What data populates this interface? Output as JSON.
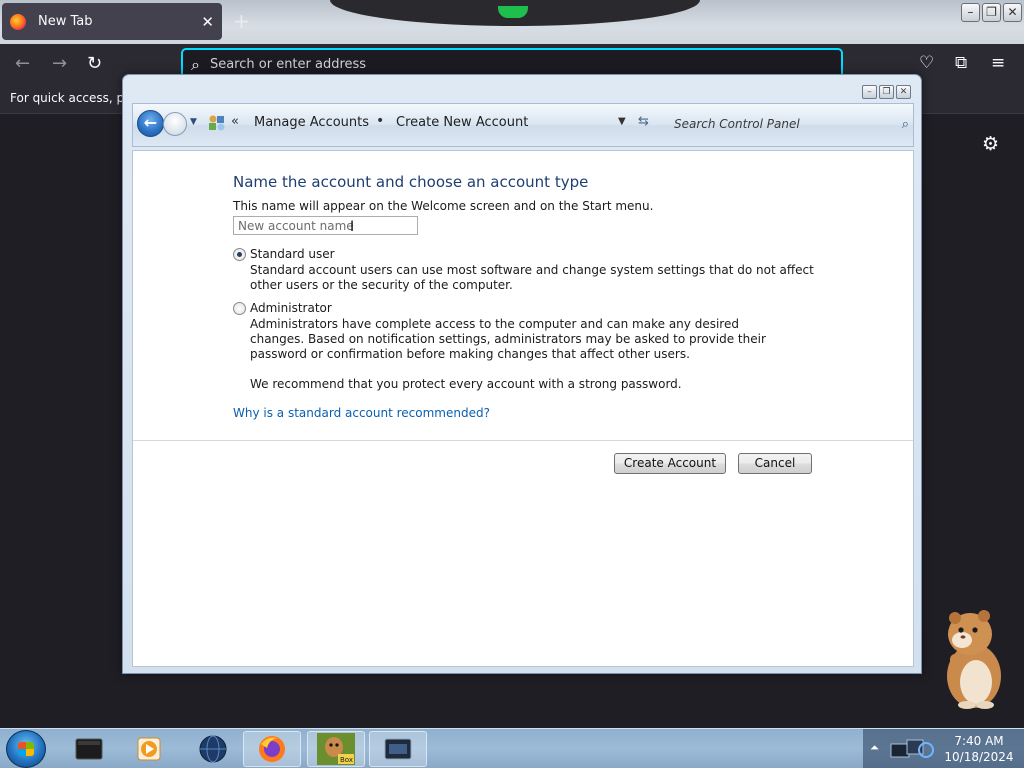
{
  "browser": {
    "tab_title": "New Tab",
    "tab_close": "✕",
    "new_tab": "+",
    "url_placeholder": "Search or enter address",
    "bookmarks_text": "For quick access, plac"
  },
  "window": {
    "minimize": "–",
    "maximize": "❐",
    "close": "✕"
  },
  "control_panel": {
    "breadcrumb": {
      "chevron": "«",
      "items": [
        "Manage Accounts",
        "Create New Account"
      ],
      "separator": "•"
    },
    "search_placeholder": "Search Control Panel",
    "heading": "Name the account and choose an account type",
    "description": "This name will appear on the Welcome screen and on the Start menu.",
    "name_placeholder": "New account name",
    "options": [
      {
        "label": "Standard user",
        "checked": true,
        "description": "Standard account users can use most software and change system settings that do not affect other users or the security of the computer."
      },
      {
        "label": "Administrator",
        "checked": false,
        "description": "Administrators have complete access to the computer and can make any desired changes. Based on notification settings, administrators may be asked to provide their password or confirmation before making changes that affect other users."
      }
    ],
    "recommendation": "We recommend that you protect every account with a strong password.",
    "help_link": "Why is a standard account recommended?",
    "buttons": {
      "create": "Create Account",
      "cancel": "Cancel"
    }
  },
  "taskbar": {
    "time": "7:40 AM",
    "date": "10/18/2024",
    "box_label": "Box"
  },
  "colors": {
    "link": "#0b5fb0",
    "heading": "#1e3f73",
    "focus_ring": "#00ddff"
  }
}
